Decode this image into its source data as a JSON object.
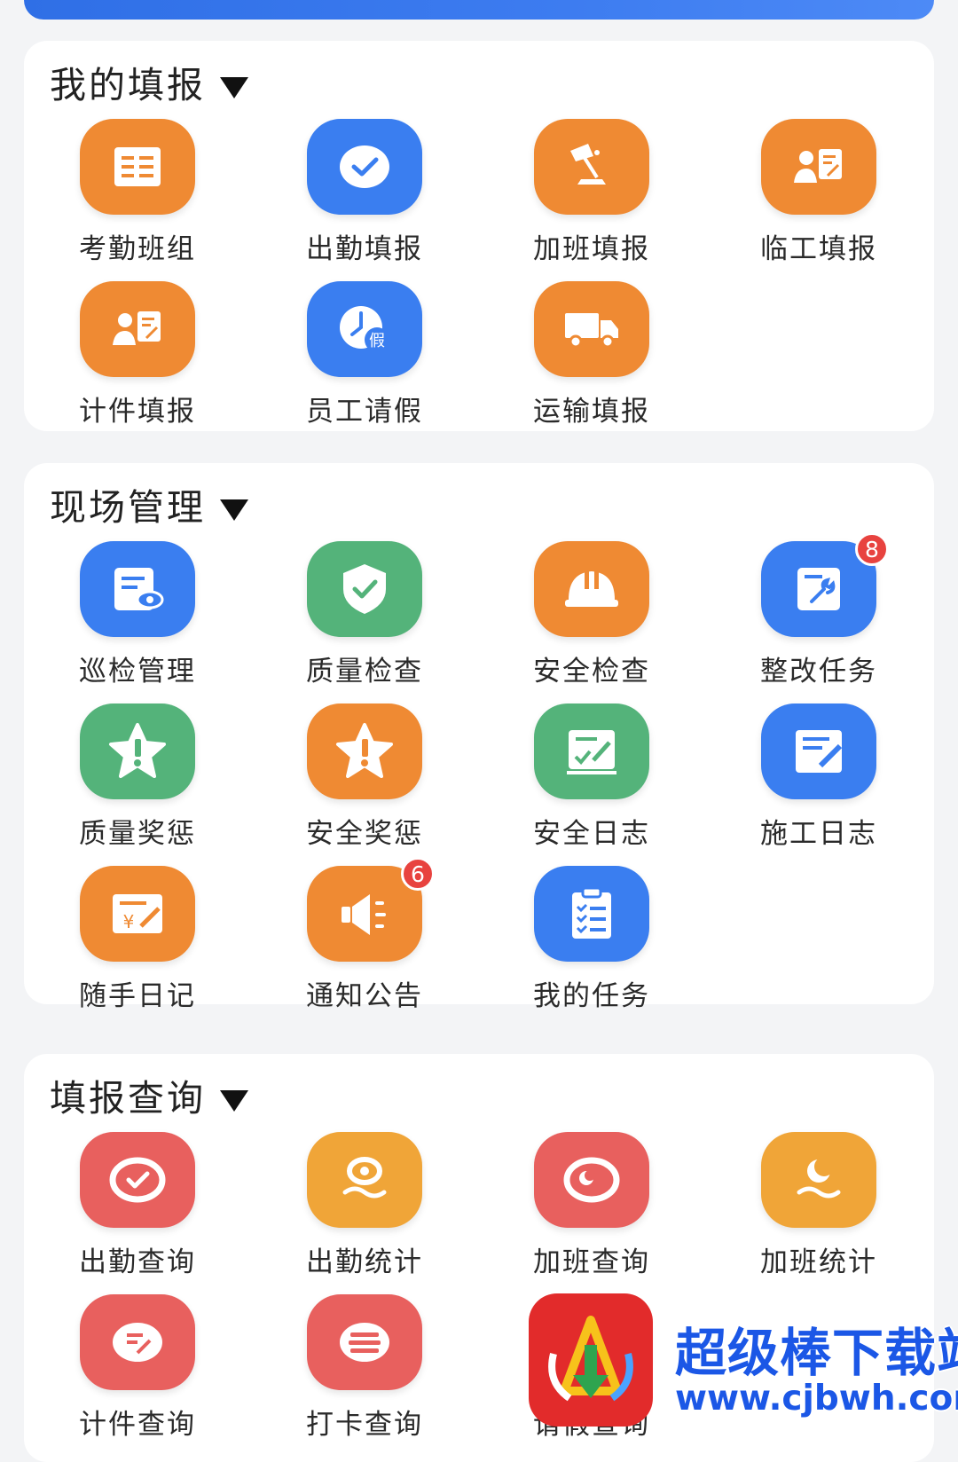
{
  "colors": {
    "orange": "#ef8a33",
    "blue": "#3a7ef0",
    "green": "#54b37a",
    "red": "#e8605e",
    "amber": "#f0a538",
    "badge": "#e8433f",
    "header_blue": "#2f6fe6"
  },
  "sections": [
    {
      "title": "我的填报",
      "items": [
        {
          "label": "考勤班组",
          "icon": "table-list-icon",
          "color": "#ef8a33"
        },
        {
          "label": "出勤填报",
          "icon": "check-circle-icon",
          "color": "#3a7ef0"
        },
        {
          "label": "加班填报",
          "icon": "desk-lamp-icon",
          "color": "#ef8a33"
        },
        {
          "label": "临工填报",
          "icon": "person-form-icon",
          "color": "#ef8a33"
        },
        {
          "label": "计件填报",
          "icon": "person-form-icon",
          "color": "#ef8a33"
        },
        {
          "label": "员工请假",
          "icon": "clock-leave-icon",
          "color": "#3a7ef0"
        },
        {
          "label": "运输填报",
          "icon": "truck-icon",
          "color": "#ef8a33"
        }
      ]
    },
    {
      "title": "现场管理",
      "items": [
        {
          "label": "巡检管理",
          "icon": "inspection-eye-icon",
          "color": "#3a7ef0"
        },
        {
          "label": "质量检查",
          "icon": "shield-check-icon",
          "color": "#54b37a"
        },
        {
          "label": "安全检查",
          "icon": "hard-hat-icon",
          "color": "#ef8a33"
        },
        {
          "label": "整改任务",
          "icon": "wrench-board-icon",
          "color": "#3a7ef0",
          "badge": "8"
        },
        {
          "label": "质量奖惩",
          "icon": "star-alert-icon",
          "color": "#54b37a"
        },
        {
          "label": "安全奖惩",
          "icon": "star-alert-icon",
          "color": "#ef8a33"
        },
        {
          "label": "安全日志",
          "icon": "log-check-icon",
          "color": "#54b37a"
        },
        {
          "label": "施工日志",
          "icon": "note-pen-icon",
          "color": "#3a7ef0"
        },
        {
          "label": "随手日记",
          "icon": "money-note-icon",
          "color": "#ef8a33"
        },
        {
          "label": "通知公告",
          "icon": "megaphone-icon",
          "color": "#ef8a33",
          "badge": "6"
        },
        {
          "label": "我的任务",
          "icon": "clipboard-list-icon",
          "color": "#3a7ef0"
        }
      ]
    },
    {
      "title": "填报查询",
      "items": [
        {
          "label": "出勤查询",
          "icon": "check-ring-icon",
          "color": "#e8605e"
        },
        {
          "label": "出勤统计",
          "icon": "sun-wave-icon",
          "color": "#f0a538"
        },
        {
          "label": "加班查询",
          "icon": "moon-ring-icon",
          "color": "#e8605e"
        },
        {
          "label": "加班统计",
          "icon": "moon-wave-icon",
          "color": "#f0a538"
        },
        {
          "label": "计件查询",
          "icon": "edit-ring-icon",
          "color": "#e8605e"
        },
        {
          "label": "打卡查询",
          "icon": "list-ring-icon",
          "color": "#e8605e"
        },
        {
          "label": "请假查询",
          "icon": "leave-query-icon",
          "color": "#e8605e"
        }
      ]
    }
  ],
  "watermark": {
    "title": "超级棒下载站",
    "url": "www.cjbwh.com"
  }
}
